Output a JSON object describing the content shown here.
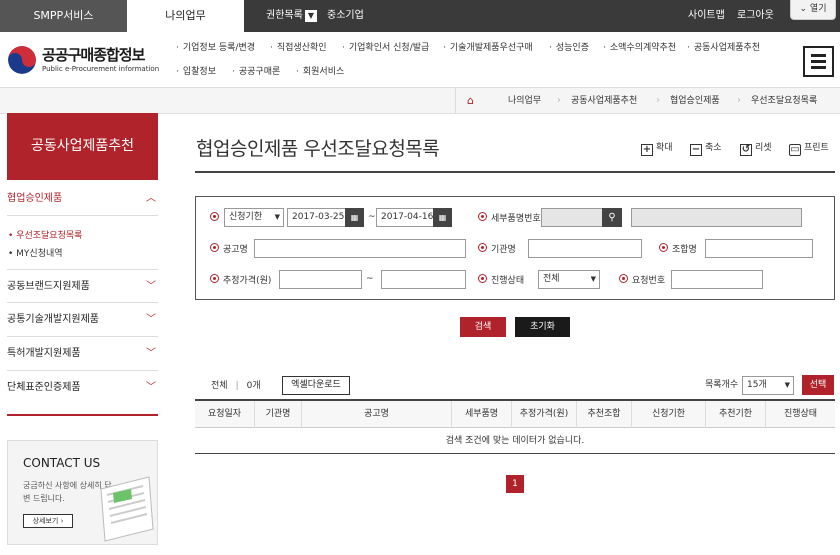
{
  "topbar": {
    "smpp_tab": "SMPP서비스",
    "mywork_tab": "나의업무",
    "role_label": "권한목록",
    "role_value": "중소기업",
    "sitemap": "사이트맵",
    "logout": "로그아웃",
    "open": "열기"
  },
  "logo": {
    "title": "공공구매종합정보",
    "subtitle": "Public e-Procurement information"
  },
  "gnb": [
    "기업정보 등록/변경",
    "직접생산확인",
    "기업확인서 신청/발급",
    "기술개발제품우선구매",
    "성능인증",
    "소액수의계약추천",
    "공동사업제품추천",
    "입찰정보",
    "공공구매론",
    "회원서비스"
  ],
  "breadcrumb": [
    "나의업무",
    "공동사업제품추천",
    "협업승인제품",
    "우선조달요청목록"
  ],
  "sidebar": {
    "title": "공동사업제품추천",
    "menu": [
      {
        "label": "협업승인제품"
      },
      {
        "label": "공동브랜드지원제품"
      },
      {
        "label": "공통기술개발지원제품"
      },
      {
        "label": "특허개발지원제품"
      },
      {
        "label": "단체표준인증제품"
      }
    ],
    "submenu": [
      "우선조달요청목록",
      "MY신청내역"
    ],
    "contact": {
      "title": "CONTACT US",
      "desc": "궁금하신 사항에 상세히 답변 드립니다.",
      "button": "상세보기"
    }
  },
  "main": {
    "title": "협업승인제품 우선조달요청목록",
    "tools": {
      "zoom_in": "확대",
      "zoom_out": "축소",
      "reset": "리셋",
      "print": "프린트"
    }
  },
  "search": {
    "period_type": "신청기한",
    "date_from": "2017-03-25",
    "date_tilde": "~",
    "date_to": "2017-04-16",
    "item_no_label": "세부품명번호",
    "notice_label": "공고명",
    "agency_label": "기관명",
    "union_label": "조합명",
    "price_label": "추정가격(원)",
    "price_tilde": "~",
    "status_label": "진행상태",
    "status_value": "전체",
    "request_no_label": "요청번호",
    "search_btn": "검색",
    "reset_btn": "초기화"
  },
  "list": {
    "total_label": "전체",
    "total_count": "0개",
    "excel_btn": "엑셀다운로드",
    "perpage_label": "목록개수",
    "perpage_value": "15개",
    "select_btn": "선택",
    "columns": [
      "요청일자",
      "기관명",
      "공고명",
      "세부품명",
      "추정가격(원)",
      "추천조합",
      "신청기한",
      "추천기한",
      "진행상태"
    ],
    "empty_message": "검색 조건에 맞는 데이터가 없습니다."
  },
  "pagination": {
    "current": "1"
  },
  "colors": {
    "accent": "#b0232a",
    "dark": "#3a3a3a"
  }
}
